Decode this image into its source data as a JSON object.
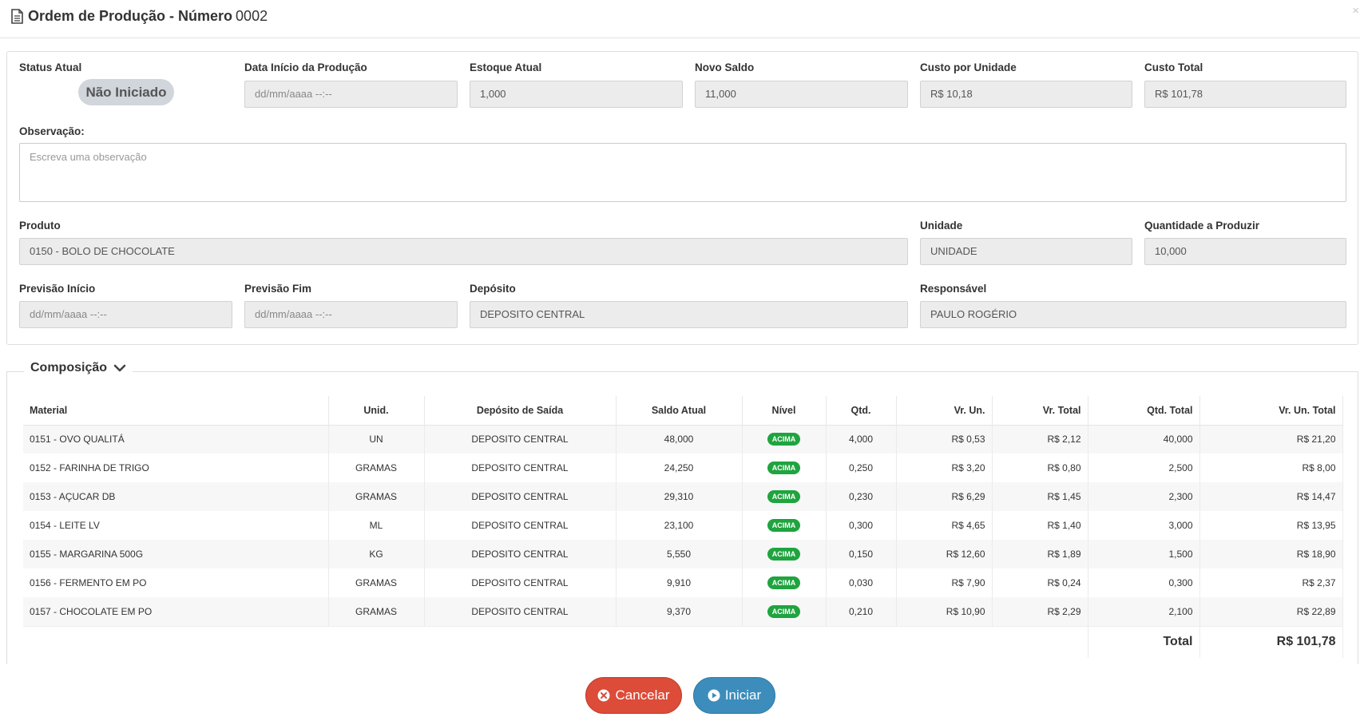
{
  "header": {
    "title": "Ordem de Produção - Número",
    "number": "0002",
    "close_label": "×"
  },
  "form": {
    "status_label": "Status Atual",
    "status_value": "Não Iniciado",
    "data_inicio_label": "Data Início da Produção",
    "data_inicio_placeholder": "dd/mm/aaaa --:--",
    "estoque_label": "Estoque Atual",
    "estoque_value": "1,000",
    "novo_saldo_label": "Novo Saldo",
    "novo_saldo_value": "11,000",
    "custo_unidade_label": "Custo por Unidade",
    "custo_unidade_value": "R$ 10,18",
    "custo_total_label": "Custo Total",
    "custo_total_value": "R$ 101,78",
    "observacao_label": "Observação:",
    "observacao_placeholder": "Escreva uma observação",
    "produto_label": "Produto",
    "produto_value": "0150 - BOLO DE CHOCOLATE",
    "unidade_label": "Unidade",
    "unidade_value": "UNIDADE",
    "quantidade_label": "Quantidade a Produzir",
    "quantidade_value": "10,000",
    "previsao_inicio_label": "Previsão Início",
    "previsao_inicio_placeholder": "dd/mm/aaaa --:--",
    "previsao_fim_label": "Previsão Fim",
    "previsao_fim_placeholder": "dd/mm/aaaa --:--",
    "deposito_label": "Depósito",
    "deposito_value": "DEPOSITO CENTRAL",
    "responsavel_label": "Responsável",
    "responsavel_value": "PAULO ROGÉRIO"
  },
  "composicao": {
    "legend": "Composição",
    "columns": [
      "Material",
      "Unid.",
      "Depósito de Saída",
      "Saldo Atual",
      "Nível",
      "Qtd.",
      "Vr. Un.",
      "Vr. Total",
      "Qtd. Total",
      "Vr. Un. Total"
    ],
    "rows": [
      [
        "0151 - OVO QUALITÁ",
        "UN",
        "DEPOSITO CENTRAL",
        "48,000",
        "ACIMA",
        "4,000",
        "R$ 0,53",
        "R$ 2,12",
        "40,000",
        "R$ 21,20"
      ],
      [
        "0152 - FARINHA DE TRIGO",
        "GRAMAS",
        "DEPOSITO CENTRAL",
        "24,250",
        "ACIMA",
        "0,250",
        "R$ 3,20",
        "R$ 0,80",
        "2,500",
        "R$ 8,00"
      ],
      [
        "0153 - AÇUCAR DB",
        "GRAMAS",
        "DEPOSITO CENTRAL",
        "29,310",
        "ACIMA",
        "0,230",
        "R$ 6,29",
        "R$ 1,45",
        "2,300",
        "R$ 14,47"
      ],
      [
        "0154 - LEITE LV",
        "ML",
        "DEPOSITO CENTRAL",
        "23,100",
        "ACIMA",
        "0,300",
        "R$ 4,65",
        "R$ 1,40",
        "3,000",
        "R$ 13,95"
      ],
      [
        "0155 - MARGARINA 500G",
        "KG",
        "DEPOSITO CENTRAL",
        "5,550",
        "ACIMA",
        "0,150",
        "R$ 12,60",
        "R$ 1,89",
        "1,500",
        "R$ 18,90"
      ],
      [
        "0156 - FERMENTO EM PO",
        "GRAMAS",
        "DEPOSITO CENTRAL",
        "9,910",
        "ACIMA",
        "0,030",
        "R$ 7,90",
        "R$ 0,24",
        "0,300",
        "R$ 2,37"
      ],
      [
        "0157 - CHOCOLATE EM PO",
        "GRAMAS",
        "DEPOSITO CENTRAL",
        "9,370",
        "ACIMA",
        "0,210",
        "R$ 10,90",
        "R$ 2,29",
        "2,100",
        "R$ 22,89"
      ]
    ],
    "total_label": "Total",
    "total_value": "R$ 101,78"
  },
  "footer": {
    "cancel_label": "Cancelar",
    "start_label": "Iniciar"
  },
  "colors": {
    "cancel": "#dd4b39",
    "start": "#3c8dbc",
    "nivel_badge": "#1fa43f",
    "status_badge": "#d1d5dc"
  },
  "icons": {
    "title": "document-icon",
    "legend": "chevron-down-icon",
    "cancel": "times-circle-icon",
    "start": "play-circle-icon"
  }
}
